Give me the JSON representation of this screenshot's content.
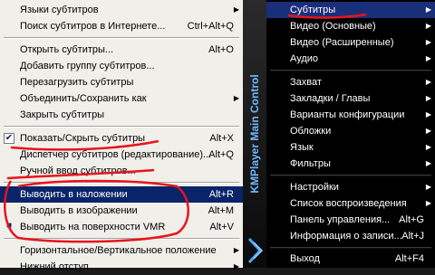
{
  "left_menu": {
    "items": [
      {
        "label": "Языки субтитров",
        "shortcut": "",
        "arrow": "▶"
      },
      {
        "label": "Поиск субтитров в Интернете...",
        "shortcut": "Ctrl+Alt+Q",
        "arrow": ""
      },
      {
        "label": "Открыть субтитры...",
        "shortcut": "Alt+O",
        "arrow": ""
      },
      {
        "label": "Добавить группу субтитров...",
        "shortcut": "",
        "arrow": ""
      },
      {
        "label": "Перезагрузить субтитры",
        "shortcut": "",
        "arrow": ""
      },
      {
        "label": "Объединить/Сохранить как",
        "shortcut": "",
        "arrow": "▶"
      },
      {
        "label": "Закрыть субтитры",
        "shortcut": "",
        "arrow": ""
      },
      {
        "label": "Показать/Скрыть субтитры",
        "shortcut": "Alt+X",
        "arrow": ""
      },
      {
        "label": "Диспетчер субтитров (редактирование)...",
        "shortcut": "Alt+Q",
        "arrow": ""
      },
      {
        "label": "Ручной ввод субтитров...",
        "shortcut": "",
        "arrow": ""
      },
      {
        "label": "Выводить в наложении",
        "shortcut": "Alt+R",
        "arrow": ""
      },
      {
        "label": "Выводить в изображении",
        "shortcut": "Alt+M",
        "arrow": ""
      },
      {
        "label": "Выводить на поверхности VMR",
        "shortcut": "Alt+V",
        "arrow": ""
      },
      {
        "label": "Горизонтальное/Вертикальное положение",
        "shortcut": "",
        "arrow": "▶"
      },
      {
        "label": "Нижний отступ",
        "shortcut": "",
        "arrow": "▶"
      }
    ]
  },
  "brand": {
    "vertical_title": "KMPlayer Main Control"
  },
  "right_menu": {
    "items": [
      {
        "label": "Субтитры",
        "shortcut": "",
        "arrow": "▶"
      },
      {
        "label": "Видео (Основные)",
        "shortcut": "",
        "arrow": "▶"
      },
      {
        "label": "Видео (Расширенные)",
        "shortcut": "",
        "arrow": "▶"
      },
      {
        "label": "Аудио",
        "shortcut": "",
        "arrow": "▶"
      },
      {
        "label": "Захват",
        "shortcut": "",
        "arrow": "▶"
      },
      {
        "label": "Закладки / Главы",
        "shortcut": "",
        "arrow": "▶"
      },
      {
        "label": "Варианты конфигурации",
        "shortcut": "",
        "arrow": "▶"
      },
      {
        "label": "Обложки",
        "shortcut": "",
        "arrow": "▶"
      },
      {
        "label": "Язык",
        "shortcut": "",
        "arrow": "▶"
      },
      {
        "label": "Фильтры",
        "shortcut": "",
        "arrow": "▶"
      },
      {
        "label": "Настройки",
        "shortcut": "",
        "arrow": "▶"
      },
      {
        "label": "Список воспроизведения",
        "shortcut": "",
        "arrow": "▶"
      },
      {
        "label": "Панель управления...",
        "shortcut": "Alt+G",
        "arrow": ""
      },
      {
        "label": "Информация о записи...",
        "shortcut": "Alt+J",
        "arrow": ""
      },
      {
        "label": "Выход",
        "shortcut": "Alt+F4",
        "arrow": ""
      }
    ]
  },
  "colors": {
    "annotation": "#e8141c",
    "selection": "#0a246a"
  }
}
